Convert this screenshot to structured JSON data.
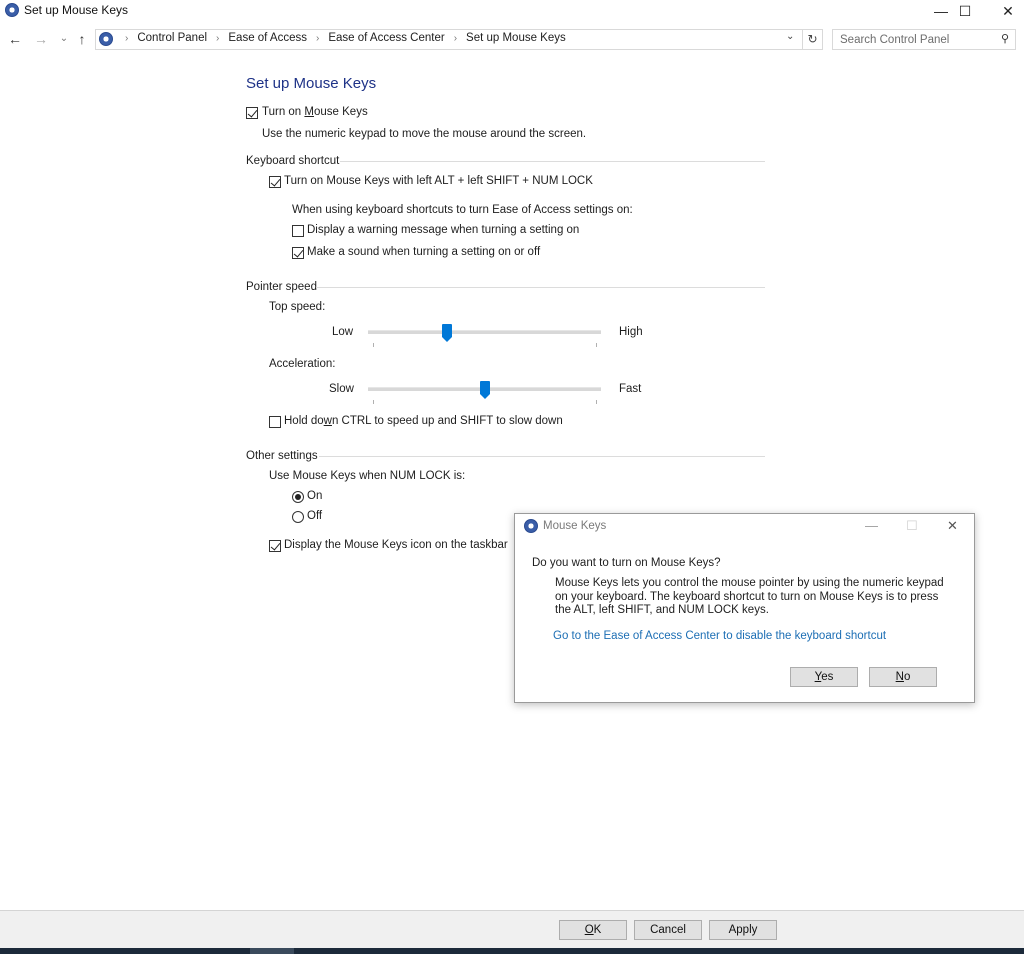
{
  "window": {
    "title": "Set up Mouse Keys",
    "icon": "ease-of-access-icon",
    "controls": {
      "minimize": "—",
      "maximize": "☐",
      "close": "✕"
    }
  },
  "nav": {
    "back_icon": "←",
    "forward_icon": "→",
    "recent_icon": "⌄",
    "up_icon": "↑",
    "breadcrumb": [
      "Control Panel",
      "Ease of Access",
      "Ease of Access Center",
      "Set up Mouse Keys"
    ],
    "breadcrumb_separator": "›",
    "dropdown_icon": "⌄",
    "refresh_icon": "↻",
    "search_placeholder": "Search Control Panel",
    "search_value": "",
    "search_icon": "⚲"
  },
  "main": {
    "title": "Set up Mouse Keys",
    "turn_on": {
      "pre": "Turn on ",
      "accel": "M",
      "post": "ouse Keys",
      "checked": true
    },
    "turn_on_desc": "Use the numeric keypad to move the mouse around the screen.",
    "keyboard_shortcut": {
      "header": "Keyboard shortcut",
      "shortcut_label": "Turn on Mouse Keys with left ALT + left SHIFT + NUM LOCK",
      "shortcut_checked": true,
      "sub_header": "When using keyboard shortcuts to turn Ease of Access settings on:",
      "warning_label": "Display a warning message when turning a setting on",
      "warning_checked": false,
      "sound_label": "Make a sound when turning a setting on or off",
      "sound_checked": true
    },
    "pointer_speed": {
      "header": "Pointer speed",
      "top_speed_label": "Top speed:",
      "top_speed_low": "Low",
      "top_speed_high": "High",
      "top_speed_value": 0.33,
      "accel_label": "Acceleration:",
      "accel_low": "Slow",
      "accel_high": "Fast",
      "accel_value": 0.5,
      "ctrl_shift": {
        "pre": "Hold do",
        "accel": "w",
        "post": "n CTRL to speed up and SHIFT to slow down",
        "checked": false
      }
    },
    "other": {
      "header": "Other settings",
      "numlock_label": "Use Mouse Keys when NUM LOCK is:",
      "on_label": "On",
      "off_label": "Off",
      "numlock_selected": "On",
      "taskbar_icon_label": "Display the Mouse Keys icon on the taskbar",
      "taskbar_icon_checked": true
    }
  },
  "dialog": {
    "title": "Mouse Keys",
    "question": "Do you want to turn on Mouse Keys?",
    "body": "Mouse Keys lets you control the mouse pointer by using the numeric keypad on your keyboard.  The keyboard shortcut to turn on Mouse Keys is to press the ALT, left SHIFT, and NUM LOCK keys.",
    "link": "Go to the Ease of Access Center to disable the keyboard shortcut",
    "yes": {
      "accel": "Y",
      "rest": "es"
    },
    "no": {
      "accel": "N",
      "rest": "o"
    }
  },
  "footer": {
    "ok": {
      "accel": "O",
      "rest": "K"
    },
    "cancel": "Cancel",
    "apply": "Apply"
  },
  "colors": {
    "accent": "#0078d7",
    "title_blue": "#1e3287",
    "link": "#1c6eb4"
  }
}
